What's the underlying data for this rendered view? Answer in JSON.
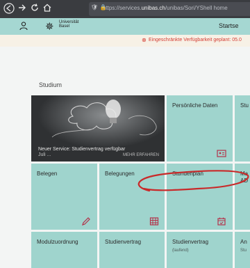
{
  "browser": {
    "url_prefix": "https://services.",
    "url_domain": "unibas.ch",
    "url_suffix": "/unibas/Sori/YShell home",
    "back_icon": "back-icon",
    "forward_icon": "forward-icon",
    "reload_icon": "reload-icon",
    "home_icon": "home-icon"
  },
  "header": {
    "logo_line1": "Universität",
    "logo_line2": "Basel",
    "start_label": "Startse"
  },
  "notice": {
    "text": "Eingeschränkte Verfügbarkeit geplant: 05.0"
  },
  "section": {
    "title": "Studium"
  },
  "promo": {
    "headline": "Neuer Service: Studienvertrag verfügbar",
    "subline": "Juli ...",
    "more": "MEHR ERFAHREN"
  },
  "tiles": {
    "persoenliche_daten": "Persönliche Daten",
    "stu_partial": "Stu",
    "belegen": "Belegen",
    "belegungen": "Belegungen",
    "stundenplan": "Stundenplan",
    "right_partial_1": "Ma",
    "right_partial_2": "AD",
    "modulzuordnung": "Modulzuordnung",
    "studienvertrag": "Studienvertrag",
    "studienvertrag_laufend": "Studienvertrag",
    "studienvertrag_laufend_sub": "(laufend)",
    "an_partial": "An",
    "an_partial_sub": "Stu"
  },
  "colors": {
    "tile": "#9fd4cd",
    "accent_red": "#d43b32",
    "header": "#a5d7d2"
  }
}
